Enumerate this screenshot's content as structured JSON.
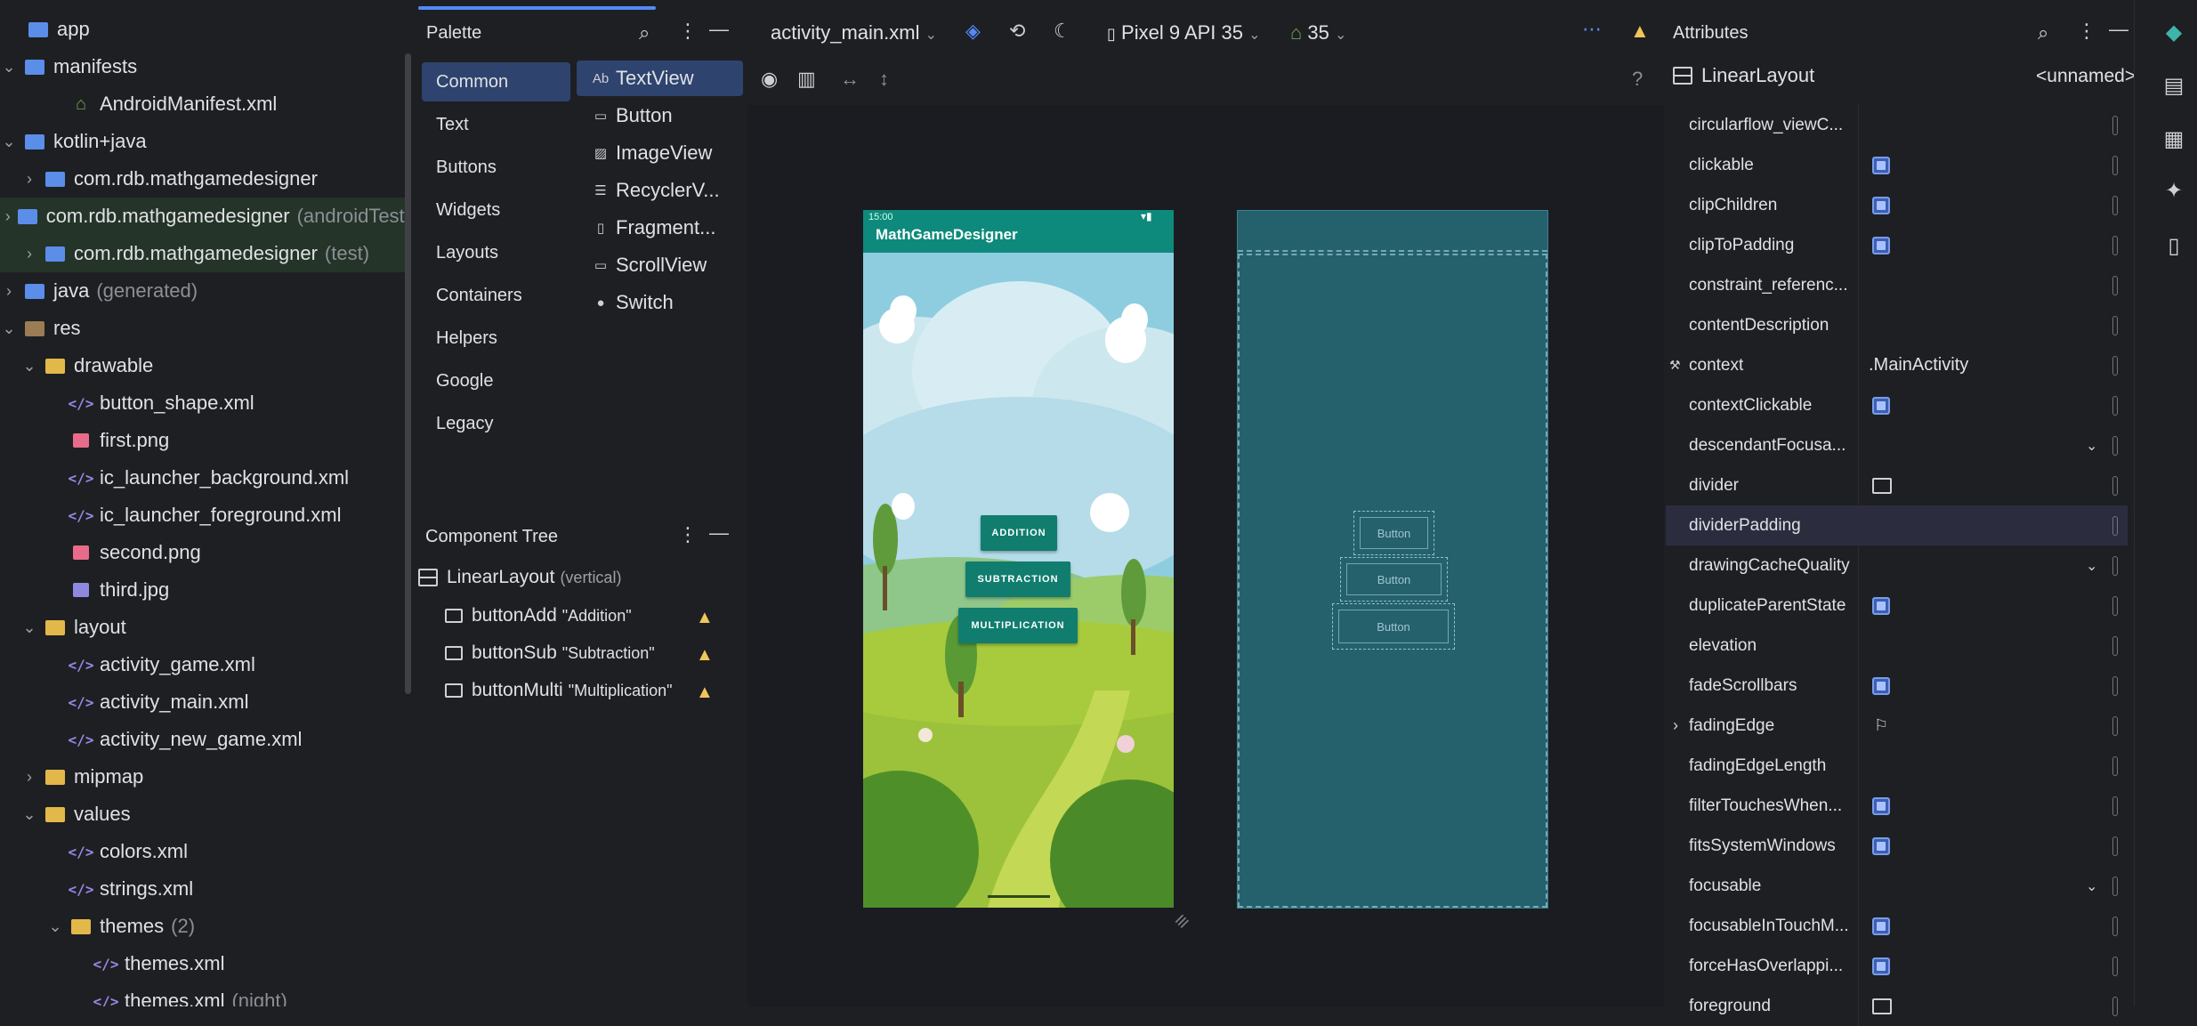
{
  "project_tree": [
    {
      "indent": 0,
      "chev": "",
      "icon": "folder-blue",
      "label": "app",
      "dim": ""
    },
    {
      "indent": 1,
      "chev": "⌄",
      "icon": "folder-blue",
      "label": "manifests",
      "dim": ""
    },
    {
      "indent": 3,
      "chev": "",
      "icon": "android",
      "label": "AndroidManifest.xml",
      "dim": ""
    },
    {
      "indent": 1,
      "chev": "⌄",
      "icon": "folder-blue",
      "label": "kotlin+java",
      "dim": ""
    },
    {
      "indent": 2,
      "chev": "›",
      "icon": "folder-blue",
      "label": "com.rdb.mathgamedesigner",
      "dim": ""
    },
    {
      "indent": 2,
      "chev": "›",
      "icon": "folder-blue",
      "label": "com.rdb.mathgamedesigner",
      "dim": "(androidTest)",
      "sel": true
    },
    {
      "indent": 2,
      "chev": "›",
      "icon": "folder-blue",
      "label": "com.rdb.mathgamedesigner",
      "dim": "(test)",
      "sel": true
    },
    {
      "indent": 1,
      "chev": "›",
      "icon": "folder-blue",
      "label": "java",
      "dim": "(generated)"
    },
    {
      "indent": 1,
      "chev": "⌄",
      "icon": "folder-res",
      "label": "res",
      "dim": ""
    },
    {
      "indent": 2,
      "chev": "⌄",
      "icon": "folder-yellow",
      "label": "drawable",
      "dim": ""
    },
    {
      "indent": 3,
      "chev": "",
      "icon": "xml",
      "label": "button_shape.xml",
      "dim": ""
    },
    {
      "indent": 3,
      "chev": "",
      "icon": "img-pink",
      "label": "first.png",
      "dim": ""
    },
    {
      "indent": 3,
      "chev": "",
      "icon": "xml",
      "label": "ic_launcher_background.xml",
      "dim": ""
    },
    {
      "indent": 3,
      "chev": "",
      "icon": "xml",
      "label": "ic_launcher_foreground.xml",
      "dim": ""
    },
    {
      "indent": 3,
      "chev": "",
      "icon": "img-pink",
      "label": "second.png",
      "dim": ""
    },
    {
      "indent": 3,
      "chev": "",
      "icon": "img-lav",
      "label": "third.jpg",
      "dim": ""
    },
    {
      "indent": 2,
      "chev": "⌄",
      "icon": "folder-yellow",
      "label": "layout",
      "dim": ""
    },
    {
      "indent": 3,
      "chev": "",
      "icon": "xml",
      "label": "activity_game.xml",
      "dim": ""
    },
    {
      "indent": 3,
      "chev": "",
      "icon": "xml",
      "label": "activity_main.xml",
      "dim": ""
    },
    {
      "indent": 3,
      "chev": "",
      "icon": "xml",
      "label": "activity_new_game.xml",
      "dim": ""
    },
    {
      "indent": 2,
      "chev": "›",
      "icon": "folder-yellow",
      "label": "mipmap",
      "dim": ""
    },
    {
      "indent": 2,
      "chev": "⌄",
      "icon": "folder-yellow",
      "label": "values",
      "dim": ""
    },
    {
      "indent": 3,
      "chev": "",
      "icon": "xml",
      "label": "colors.xml",
      "dim": ""
    },
    {
      "indent": 3,
      "chev": "",
      "icon": "xml",
      "label": "strings.xml",
      "dim": ""
    },
    {
      "indent": 3,
      "chev": "⌄",
      "icon": "folder-yellow",
      "label": "themes",
      "dim": "(2)"
    },
    {
      "indent": 4,
      "chev": "",
      "icon": "xml",
      "label": "themes.xml",
      "dim": ""
    },
    {
      "indent": 4,
      "chev": "",
      "icon": "xml",
      "label": "themes.xml",
      "dim": "(night)"
    }
  ],
  "palette": {
    "title": "Palette",
    "categories": [
      "Common",
      "Text",
      "Buttons",
      "Widgets",
      "Layouts",
      "Containers",
      "Helpers",
      "Google",
      "Legacy"
    ],
    "items": [
      {
        "icon": "Ab",
        "label": "TextView"
      },
      {
        "icon": "▭",
        "label": "Button"
      },
      {
        "icon": "▨",
        "label": "ImageView"
      },
      {
        "icon": "☰",
        "label": "RecyclerV..."
      },
      {
        "icon": "▯",
        "label": "Fragment..."
      },
      {
        "icon": "▭",
        "label": "ScrollView"
      },
      {
        "icon": "●",
        "label": "Switch"
      }
    ]
  },
  "component_tree": {
    "title": "Component Tree",
    "root": {
      "label": "LinearLayout",
      "sub": "(vertical)"
    },
    "children": [
      {
        "label": "buttonAdd",
        "sub": "\"Addition\""
      },
      {
        "label": "buttonSub",
        "sub": "\"Subtraction\""
      },
      {
        "label": "buttonMulti",
        "sub": "\"Multiplication\""
      }
    ]
  },
  "editor": {
    "file": "activity_main.xml",
    "device": "Pixel 9 API 35",
    "api": "35",
    "phone": {
      "time": "15:00",
      "app_title": "MathGameDesigner",
      "buttons": [
        "ADDITION",
        "SUBTRACTION",
        "MULTIPLICATION"
      ]
    },
    "blueprint_buttons": [
      "Button",
      "Button",
      "Button"
    ]
  },
  "attributes": {
    "title": "Attributes",
    "view": "LinearLayout",
    "id": "<unnamed>",
    "rows": [
      {
        "name": "circularflow_viewC...",
        "kind": "text",
        "value": ""
      },
      {
        "name": "clickable",
        "kind": "check"
      },
      {
        "name": "clipChildren",
        "kind": "check"
      },
      {
        "name": "clipToPadding",
        "kind": "check"
      },
      {
        "name": "constraint_referenc...",
        "kind": "text",
        "value": ""
      },
      {
        "name": "contentDescription",
        "kind": "text",
        "value": ""
      },
      {
        "name": "context",
        "kind": "text",
        "value": ".MainActivity",
        "tool": true
      },
      {
        "name": "contextClickable",
        "kind": "check"
      },
      {
        "name": "descendantFocusa...",
        "kind": "dropdown"
      },
      {
        "name": "divider",
        "kind": "image"
      },
      {
        "name": "dividerPadding",
        "kind": "text",
        "value": "",
        "sel": true
      },
      {
        "name": "drawingCacheQuality",
        "kind": "dropdown"
      },
      {
        "name": "duplicateParentState",
        "kind": "check"
      },
      {
        "name": "elevation",
        "kind": "text",
        "value": ""
      },
      {
        "name": "fadeScrollbars",
        "kind": "check"
      },
      {
        "name": "fadingEdge",
        "kind": "flag",
        "expand": true
      },
      {
        "name": "fadingEdgeLength",
        "kind": "text",
        "value": ""
      },
      {
        "name": "filterTouchesWhen...",
        "kind": "check"
      },
      {
        "name": "fitsSystemWindows",
        "kind": "check"
      },
      {
        "name": "focusable",
        "kind": "dropdown"
      },
      {
        "name": "focusableInTouchM...",
        "kind": "check"
      },
      {
        "name": "forceHasOverlappi...",
        "kind": "check"
      },
      {
        "name": "foreground",
        "kind": "image"
      }
    ]
  }
}
